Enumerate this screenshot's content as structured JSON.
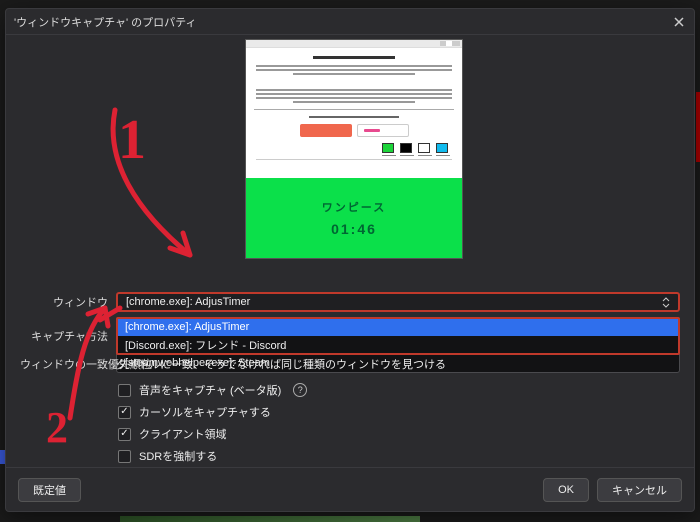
{
  "dialog": {
    "title": "'ウィンドウキャプチャ' のプロパティ"
  },
  "preview": {
    "green_title": "ワンピース",
    "green_timer": "01:46"
  },
  "form": {
    "window_label": "ウィンドウ",
    "window_value": "[chrome.exe]: AdjusTimer",
    "capture_label": "キャプチャ方法",
    "priority_label": "ウィンドウの一致優先順位",
    "priority_value_tail": "タイトルに一致、そうでなければ同じ種類のウィンドウを見つける"
  },
  "dropdown": {
    "options": [
      "[chrome.exe]: AdjusTimer",
      "[Discord.exe]: フレンド - Discord",
      "[steamwebhelper.exe]: Steam"
    ]
  },
  "checks": {
    "audio": "音声をキャプチャ (ベータ版)",
    "cursor": "カーソルをキャプチャする",
    "client": "クライアント領域",
    "sdr": "SDRを強制する"
  },
  "footer": {
    "defaults": "既定値",
    "ok": "OK",
    "cancel": "キャンセル"
  },
  "anno": {
    "one": "1",
    "two": "2"
  }
}
